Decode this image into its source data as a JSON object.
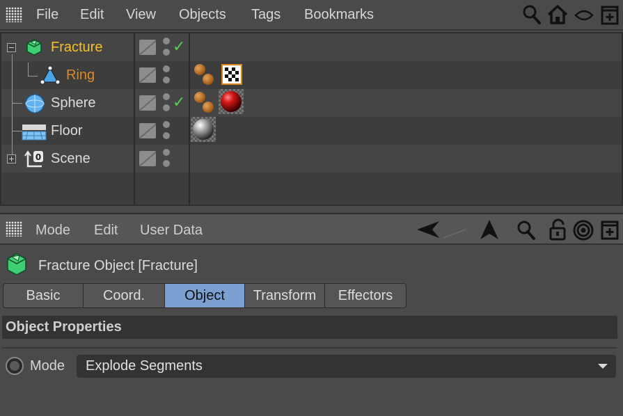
{
  "object_manager": {
    "menu": [
      "File",
      "Edit",
      "View",
      "Objects",
      "Tags",
      "Bookmarks"
    ],
    "header_icons": [
      "search-icon",
      "home-icon",
      "eye-icon",
      "new-panel-icon"
    ],
    "objects": [
      {
        "name": "Fracture",
        "icon": "fracture-icon",
        "state": "active",
        "visible_check": true
      },
      {
        "name": "Ring",
        "icon": "ring-spline-icon",
        "state": "child",
        "visible_check": false
      },
      {
        "name": "Sphere",
        "icon": "sphere-icon",
        "state": "normal",
        "visible_check": true
      },
      {
        "name": "Floor",
        "icon": "floor-icon",
        "state": "normal",
        "visible_check": false
      },
      {
        "name": "Scene",
        "icon": "scene-null-icon",
        "state": "normal",
        "visible_check": false
      }
    ],
    "check_glyph": "✓"
  },
  "attribute_manager": {
    "menu": [
      "Mode",
      "Edit",
      "User Data"
    ],
    "header_icons": [
      "back-arrow-icon",
      "forward-arrow-icon",
      "up-arrow-icon",
      "search-icon",
      "lock-icon",
      "target-icon",
      "new-panel-icon"
    ],
    "title": "Fracture Object [Fracture]",
    "tabs": [
      {
        "label": "Basic",
        "selected": false
      },
      {
        "label": "Coord.",
        "selected": false
      },
      {
        "label": "Object",
        "selected": true
      },
      {
        "label": "Transform",
        "selected": false
      },
      {
        "label": "Effectors",
        "selected": false
      }
    ],
    "section_title": "Object Properties",
    "mode_label": "Mode",
    "mode_value": "Explode Segments"
  },
  "colors": {
    "active_object": "#f5c125",
    "child_object": "#d98a25",
    "selected_tab": "#7b9fd0",
    "check": "#4fd24f"
  }
}
